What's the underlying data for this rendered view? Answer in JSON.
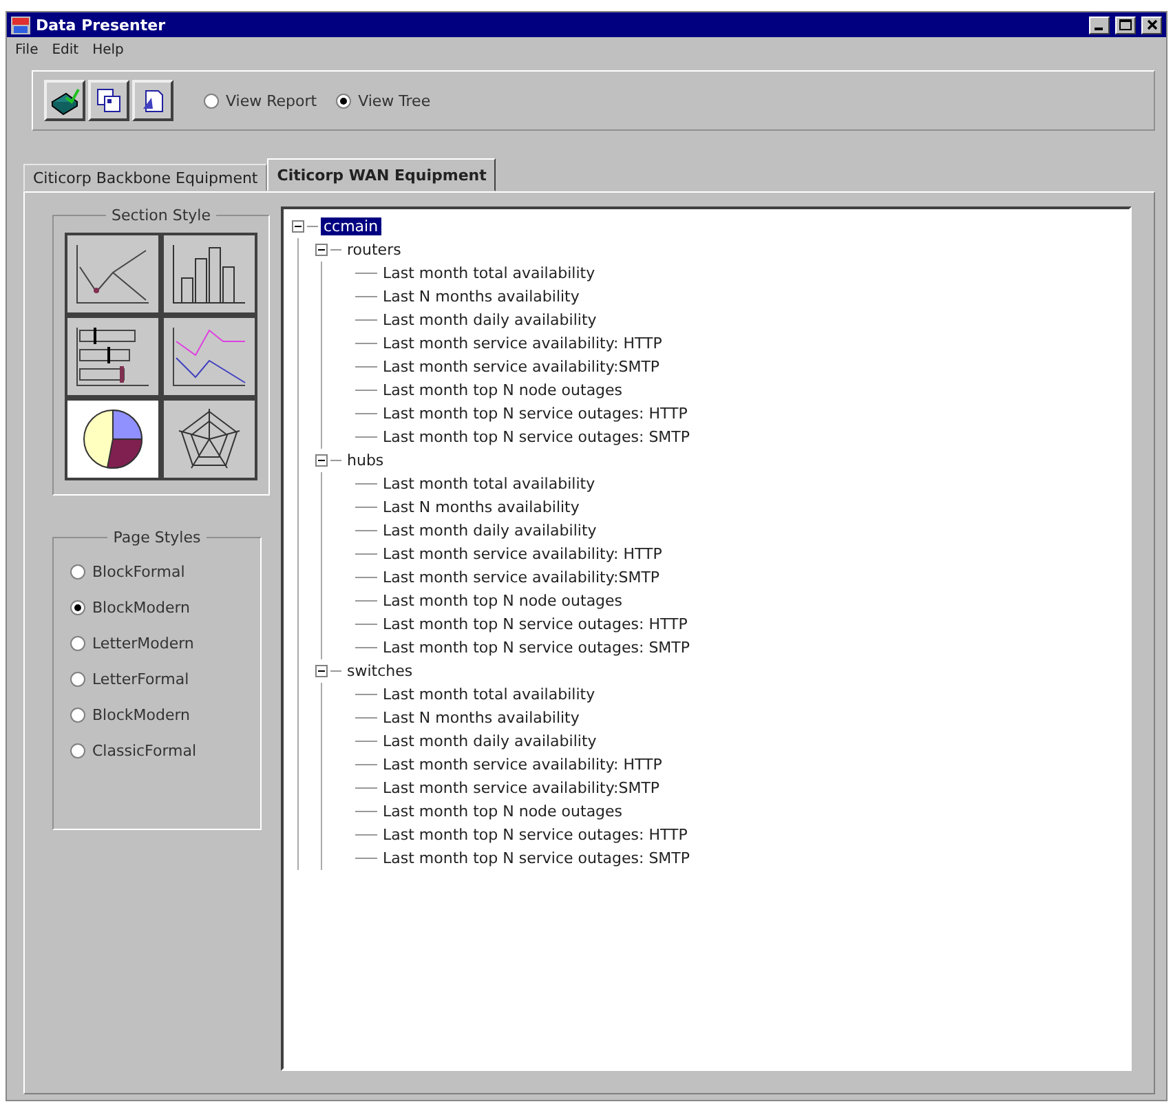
{
  "window": {
    "title": "Data Presenter"
  },
  "menu": [
    "File",
    "Edit",
    "Help"
  ],
  "view_options": [
    {
      "label": "View Report",
      "selected": false
    },
    {
      "label": "View Tree",
      "selected": true
    }
  ],
  "tabs": [
    {
      "label": "Citicorp Backbone Equipment",
      "selected": false
    },
    {
      "label": "Citicorp WAN Equipment",
      "selected": true
    }
  ],
  "section_style": {
    "title": "Section Style",
    "items": [
      {
        "kind": "line",
        "selected": false
      },
      {
        "kind": "bar",
        "selected": false
      },
      {
        "kind": "gantt",
        "selected": false
      },
      {
        "kind": "multiline",
        "selected": false
      },
      {
        "kind": "pie",
        "selected": true
      },
      {
        "kind": "radar",
        "selected": false
      }
    ]
  },
  "page_styles": {
    "title": "Page Styles",
    "items": [
      {
        "label": "BlockFormal",
        "selected": false
      },
      {
        "label": "BlockModern",
        "selected": true
      },
      {
        "label": "LetterModern",
        "selected": false
      },
      {
        "label": "LetterFormal",
        "selected": false
      },
      {
        "label": "BlockModern",
        "selected": false
      },
      {
        "label": "ClassicFormal",
        "selected": false
      }
    ]
  },
  "tree": {
    "label": "ccmain",
    "selected": true,
    "expanded": true,
    "children": [
      {
        "label": "routers",
        "selected": false,
        "expanded": true,
        "children": [
          {
            "label": "Last month total availability"
          },
          {
            "label": "Last N months availability"
          },
          {
            "label": "Last month daily availability"
          },
          {
            "label": "Last month service availability: HTTP"
          },
          {
            "label": "Last month service availability:SMTP"
          },
          {
            "label": "Last month top N node outages"
          },
          {
            "label": "Last month top N service outages: HTTP"
          },
          {
            "label": "Last month top N service outages: SMTP"
          }
        ]
      },
      {
        "label": "hubs",
        "selected": false,
        "expanded": true,
        "children": [
          {
            "label": "Last month total availability"
          },
          {
            "label": "Last N months availability"
          },
          {
            "label": "Last month daily availability"
          },
          {
            "label": "Last month service availability: HTTP"
          },
          {
            "label": "Last month service availability:SMTP"
          },
          {
            "label": "Last month top N node outages"
          },
          {
            "label": "Last month top N service outages: HTTP"
          },
          {
            "label": "Last month top N service outages: SMTP"
          }
        ]
      },
      {
        "label": "switches",
        "selected": false,
        "expanded": true,
        "children": [
          {
            "label": "Last month total availability"
          },
          {
            "label": "Last N months availability"
          },
          {
            "label": "Last month daily availability"
          },
          {
            "label": "Last month service availability: HTTP"
          },
          {
            "label": "Last month service availability:SMTP"
          },
          {
            "label": "Last month top N node outages"
          },
          {
            "label": "Last month top N service outages: HTTP"
          },
          {
            "label": "Last month top N service outages: SMTP"
          }
        ]
      }
    ]
  }
}
